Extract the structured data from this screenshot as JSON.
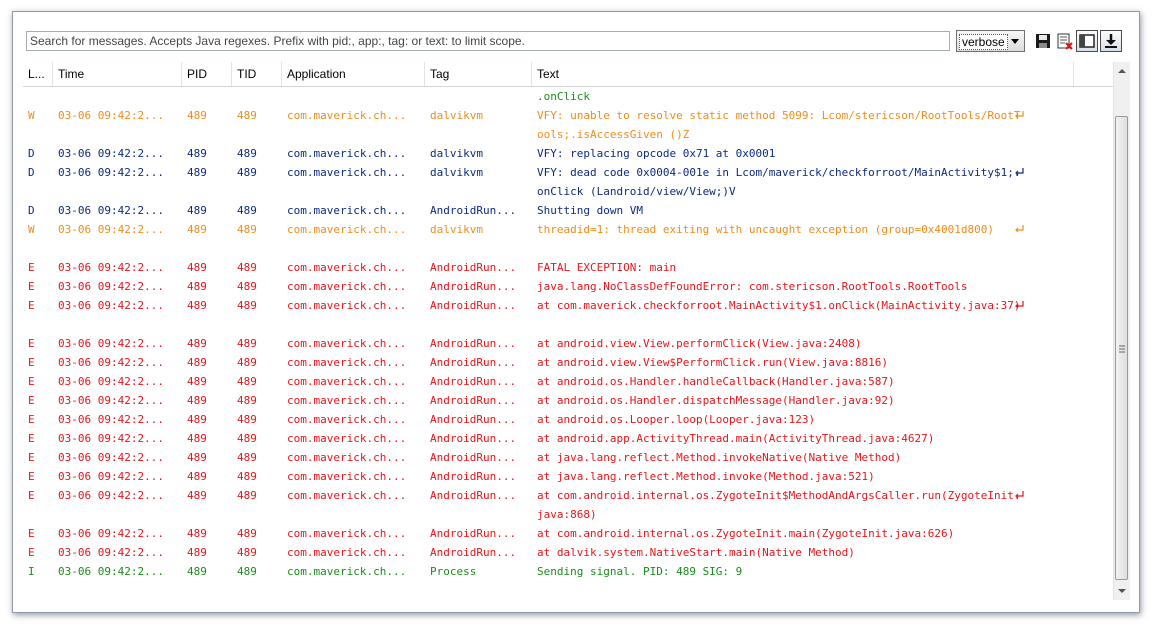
{
  "toolbar": {
    "search_placeholder": "Search for messages. Accepts Java regexes. Prefix with pid:, app:, tag: or text: to limit scope.",
    "level_value": "verbose",
    "icons": [
      "save-icon",
      "clear-log-icon",
      "toggle-panel-icon",
      "scroll-lock-icon"
    ]
  },
  "columns": [
    "L...",
    "Time",
    "PID",
    "TID",
    "Application",
    "Tag",
    "Text"
  ],
  "rows": [
    {
      "level": "",
      "time": "",
      "pid": "",
      "tid": "",
      "app": "",
      "tag": "",
      "text": ".onClick",
      "color_level": "I",
      "wrap": false,
      "lines": 1
    },
    {
      "level": "W",
      "time": "03-06 09:42:2...",
      "pid": "489",
      "tid": "489",
      "app": "com.maverick.ch...",
      "tag": "dalvikvm",
      "text": "VFY: unable to resolve static method 5099: Lcom/stericson/RootTools/RootTools;.isAccessGiven ()Z",
      "color_level": "W",
      "wrap": true,
      "lines": 2
    },
    {
      "level": "D",
      "time": "03-06 09:42:2...",
      "pid": "489",
      "tid": "489",
      "app": "com.maverick.ch...",
      "tag": "dalvikvm",
      "text": "VFY: replacing opcode 0x71 at 0x0001",
      "color_level": "D",
      "wrap": false,
      "lines": 1
    },
    {
      "level": "D",
      "time": "03-06 09:42:2...",
      "pid": "489",
      "tid": "489",
      "app": "com.maverick.ch...",
      "tag": "dalvikvm",
      "text": "VFY: dead code 0x0004-001e in Lcom/maverick/checkforroot/MainActivity$1;.onClick (Landroid/view/View;)V",
      "color_level": "D",
      "wrap": true,
      "lines": 2
    },
    {
      "level": "D",
      "time": "03-06 09:42:2...",
      "pid": "489",
      "tid": "489",
      "app": "com.maverick.ch...",
      "tag": "AndroidRun...",
      "text": "Shutting down VM",
      "color_level": "D",
      "wrap": false,
      "lines": 1
    },
    {
      "level": "W",
      "time": "03-06 09:42:2...",
      "pid": "489",
      "tid": "489",
      "app": "com.maverick.ch...",
      "tag": "dalvikvm",
      "text": "threadid=1: thread exiting with uncaught exception (group=0x4001d800)",
      "color_level": "W",
      "wrap": true,
      "lines": 2
    },
    {
      "level": "E",
      "time": "03-06 09:42:2...",
      "pid": "489",
      "tid": "489",
      "app": "com.maverick.ch...",
      "tag": "AndroidRun...",
      "text": "FATAL EXCEPTION: main",
      "color_level": "E",
      "wrap": false,
      "lines": 1
    },
    {
      "level": "E",
      "time": "03-06 09:42:2...",
      "pid": "489",
      "tid": "489",
      "app": "com.maverick.ch...",
      "tag": "AndroidRun...",
      "text": "java.lang.NoClassDefFoundError: com.stericson.RootTools.RootTools",
      "color_level": "E",
      "wrap": false,
      "lines": 1
    },
    {
      "level": "E",
      "time": "03-06 09:42:2...",
      "pid": "489",
      "tid": "489",
      "app": "com.maverick.ch...",
      "tag": "AndroidRun...",
      "text": "at com.maverick.checkforroot.MainActivity$1.onClick(MainActivity.java:37)",
      "color_level": "E",
      "wrap": true,
      "lines": 2
    },
    {
      "level": "E",
      "time": "03-06 09:42:2...",
      "pid": "489",
      "tid": "489",
      "app": "com.maverick.ch...",
      "tag": "AndroidRun...",
      "text": "at android.view.View.performClick(View.java:2408)",
      "color_level": "E",
      "wrap": false,
      "lines": 1
    },
    {
      "level": "E",
      "time": "03-06 09:42:2...",
      "pid": "489",
      "tid": "489",
      "app": "com.maverick.ch...",
      "tag": "AndroidRun...",
      "text": "at android.view.View$PerformClick.run(View.java:8816)",
      "color_level": "E",
      "wrap": false,
      "lines": 1
    },
    {
      "level": "E",
      "time": "03-06 09:42:2...",
      "pid": "489",
      "tid": "489",
      "app": "com.maverick.ch...",
      "tag": "AndroidRun...",
      "text": "at android.os.Handler.handleCallback(Handler.java:587)",
      "color_level": "E",
      "wrap": false,
      "lines": 1
    },
    {
      "level": "E",
      "time": "03-06 09:42:2...",
      "pid": "489",
      "tid": "489",
      "app": "com.maverick.ch...",
      "tag": "AndroidRun...",
      "text": "at android.os.Handler.dispatchMessage(Handler.java:92)",
      "color_level": "E",
      "wrap": false,
      "lines": 1
    },
    {
      "level": "E",
      "time": "03-06 09:42:2...",
      "pid": "489",
      "tid": "489",
      "app": "com.maverick.ch...",
      "tag": "AndroidRun...",
      "text": "at android.os.Looper.loop(Looper.java:123)",
      "color_level": "E",
      "wrap": false,
      "lines": 1
    },
    {
      "level": "E",
      "time": "03-06 09:42:2...",
      "pid": "489",
      "tid": "489",
      "app": "com.maverick.ch...",
      "tag": "AndroidRun...",
      "text": "at android.app.ActivityThread.main(ActivityThread.java:4627)",
      "color_level": "E",
      "wrap": false,
      "lines": 1
    },
    {
      "level": "E",
      "time": "03-06 09:42:2...",
      "pid": "489",
      "tid": "489",
      "app": "com.maverick.ch...",
      "tag": "AndroidRun...",
      "text": "at java.lang.reflect.Method.invokeNative(Native Method)",
      "color_level": "E",
      "wrap": false,
      "lines": 1
    },
    {
      "level": "E",
      "time": "03-06 09:42:2...",
      "pid": "489",
      "tid": "489",
      "app": "com.maverick.ch...",
      "tag": "AndroidRun...",
      "text": "at java.lang.reflect.Method.invoke(Method.java:521)",
      "color_level": "E",
      "wrap": false,
      "lines": 1
    },
    {
      "level": "E",
      "time": "03-06 09:42:2...",
      "pid": "489",
      "tid": "489",
      "app": "com.maverick.ch...",
      "tag": "AndroidRun...",
      "text": "at com.android.internal.os.ZygoteInit$MethodAndArgsCaller.run(ZygoteInit.java:868)",
      "color_level": "E",
      "wrap": true,
      "lines": 2
    },
    {
      "level": "E",
      "time": "03-06 09:42:2...",
      "pid": "489",
      "tid": "489",
      "app": "com.maverick.ch...",
      "tag": "AndroidRun...",
      "text": "at com.android.internal.os.ZygoteInit.main(ZygoteInit.java:626)",
      "color_level": "E",
      "wrap": false,
      "lines": 1
    },
    {
      "level": "E",
      "time": "03-06 09:42:2...",
      "pid": "489",
      "tid": "489",
      "app": "com.maverick.ch...",
      "tag": "AndroidRun...",
      "text": "at dalvik.system.NativeStart.main(Native Method)",
      "color_level": "E",
      "wrap": false,
      "lines": 1
    },
    {
      "level": "I",
      "time": "03-06 09:42:2...",
      "pid": "489",
      "tid": "489",
      "app": "com.maverick.ch...",
      "tag": "Process",
      "text": "Sending signal. PID: 489 SIG: 9",
      "color_level": "I",
      "wrap": false,
      "lines": 1
    }
  ],
  "colors": {
    "W": "#f08c1a",
    "D": "#0c2a80",
    "E": "#e8141b",
    "I": "#1a8c1a"
  }
}
